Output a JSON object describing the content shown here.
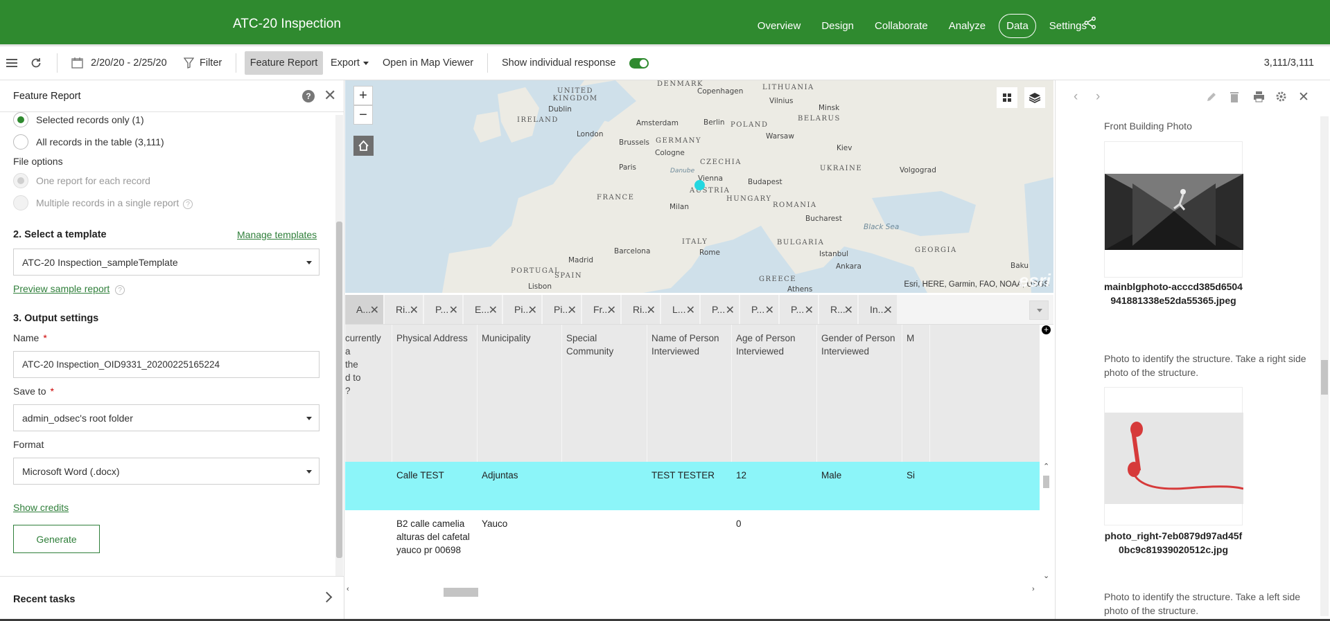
{
  "header": {
    "app_title": "ATC-20 Inspection",
    "nav": [
      "Overview",
      "Design",
      "Collaborate",
      "Analyze",
      "Data",
      "Settings"
    ],
    "active_nav": "Data"
  },
  "toolbar": {
    "date_range": "2/20/20 - 2/25/20",
    "filter": "Filter",
    "feature_report": "Feature Report",
    "export": "Export",
    "open_map_viewer": "Open in Map Viewer",
    "show_individual": "Show individual response",
    "count": "3,111/3,111"
  },
  "left_panel": {
    "title": "Feature Report",
    "option_selected": "Selected records only (1)",
    "option_all": "All records in the table (3,111)",
    "file_options_label": "File options",
    "file_option_each": "One report for each record",
    "file_option_single": "Multiple records in a single report",
    "section2": "2. Select a template",
    "manage_templates": "Manage templates",
    "template_value": "ATC-20 Inspection_sampleTemplate",
    "preview_link": "Preview sample report",
    "section3": "3. Output settings",
    "name_label": "Name",
    "name_value": "ATC-20 Inspection_OID9331_20200225165224",
    "save_to_label": "Save to",
    "save_to_value": "admin_odsec's root folder",
    "format_label": "Format",
    "format_value": "Microsoft Word (.docx)",
    "show_credits": "Show credits",
    "generate": "Generate",
    "recent_tasks": "Recent tasks"
  },
  "map": {
    "attribution": "Esri, HERE, Garmin, FAO, NOAA, USGS",
    "logo": "esri",
    "labels": {
      "denmark": "DENMARK",
      "uk": "UNITED KINGDOM",
      "dublin": "Dublin",
      "ireland": "IRELAND",
      "london": "London",
      "amsterdam": "Amsterdam",
      "copenhagen": "Copenhagen",
      "lithuania": "LITHUANIA",
      "vilnius": "Vilnius",
      "minsk": "Minsk",
      "belarus": "BELARUS",
      "berlin": "Berlin",
      "poland": "POLAND",
      "warsaw": "Warsaw",
      "germany": "GERMANY",
      "brussels": "Brussels",
      "cologne": "Cologne",
      "kiev": "Kiev",
      "czechia": "CZECHIA",
      "paris": "Paris",
      "ukraine": "UKRAINE",
      "vienna": "Vienna",
      "budapest": "Budapest",
      "volgograd": "Volgograd",
      "austria": "AUSTRIA",
      "france": "FRANCE",
      "hungary": "HUNGARY",
      "romania": "ROMANIA",
      "milan": "Milan",
      "bucharest": "Bucharest",
      "black_sea": "Black Sea",
      "italy": "ITALY",
      "bulgaria": "BULGARIA",
      "barcelona": "Barcelona",
      "rome": "Rome",
      "istanbul": "Istanbul",
      "georgia": "GEORGIA",
      "madrid": "Madrid",
      "portugal": "PORTUGAL",
      "spain": "SPAIN",
      "greece": "GREECE",
      "ankara": "Ankara",
      "baku": "Baku",
      "lisbon": "Lisbon",
      "athens": "Athens",
      "danube": "Danube"
    }
  },
  "table": {
    "tabs": [
      "A...",
      "Ri...",
      "P...",
      "E...",
      "Pi...",
      "Pi...",
      "Fr...",
      "Ri...",
      "L...",
      "P...",
      "P...",
      "P...",
      "R...",
      "In..."
    ],
    "columns": [
      "currently a\nthe\nd to\n?",
      "Physical Address",
      "Municipality",
      "Special Community",
      "Name of Person Interviewed",
      "Age of Person Interviewed",
      "Gender of Person Interviewed",
      "M"
    ],
    "rows": [
      [
        "",
        "Calle TEST",
        "Adjuntas",
        "",
        "TEST TESTER",
        "12",
        "Male",
        "Si"
      ],
      [
        "",
        "B2 calle camelia alturas del cafetal yauco pr 00698",
        "Yauco",
        "",
        "",
        "0",
        "",
        ""
      ]
    ]
  },
  "right_panel": {
    "front_photo_label": "Front Building Photo",
    "front_photo_name": "mainblgphoto-acccd385d6504941881338e52da55365.jpeg",
    "right_photo_desc": "Photo to identify the structure. Take a right side photo of the structure.",
    "right_photo_name": "photo_right-7eb0879d97ad45f0bc9c81939020512c.jpg",
    "left_photo_desc": "Photo to identify the structure. Take a left side photo of the structure."
  },
  "colors": {
    "brand_green": "#2f8a2f",
    "selected_row": "#8cf5f9",
    "map_marker": "#23d7e0"
  }
}
